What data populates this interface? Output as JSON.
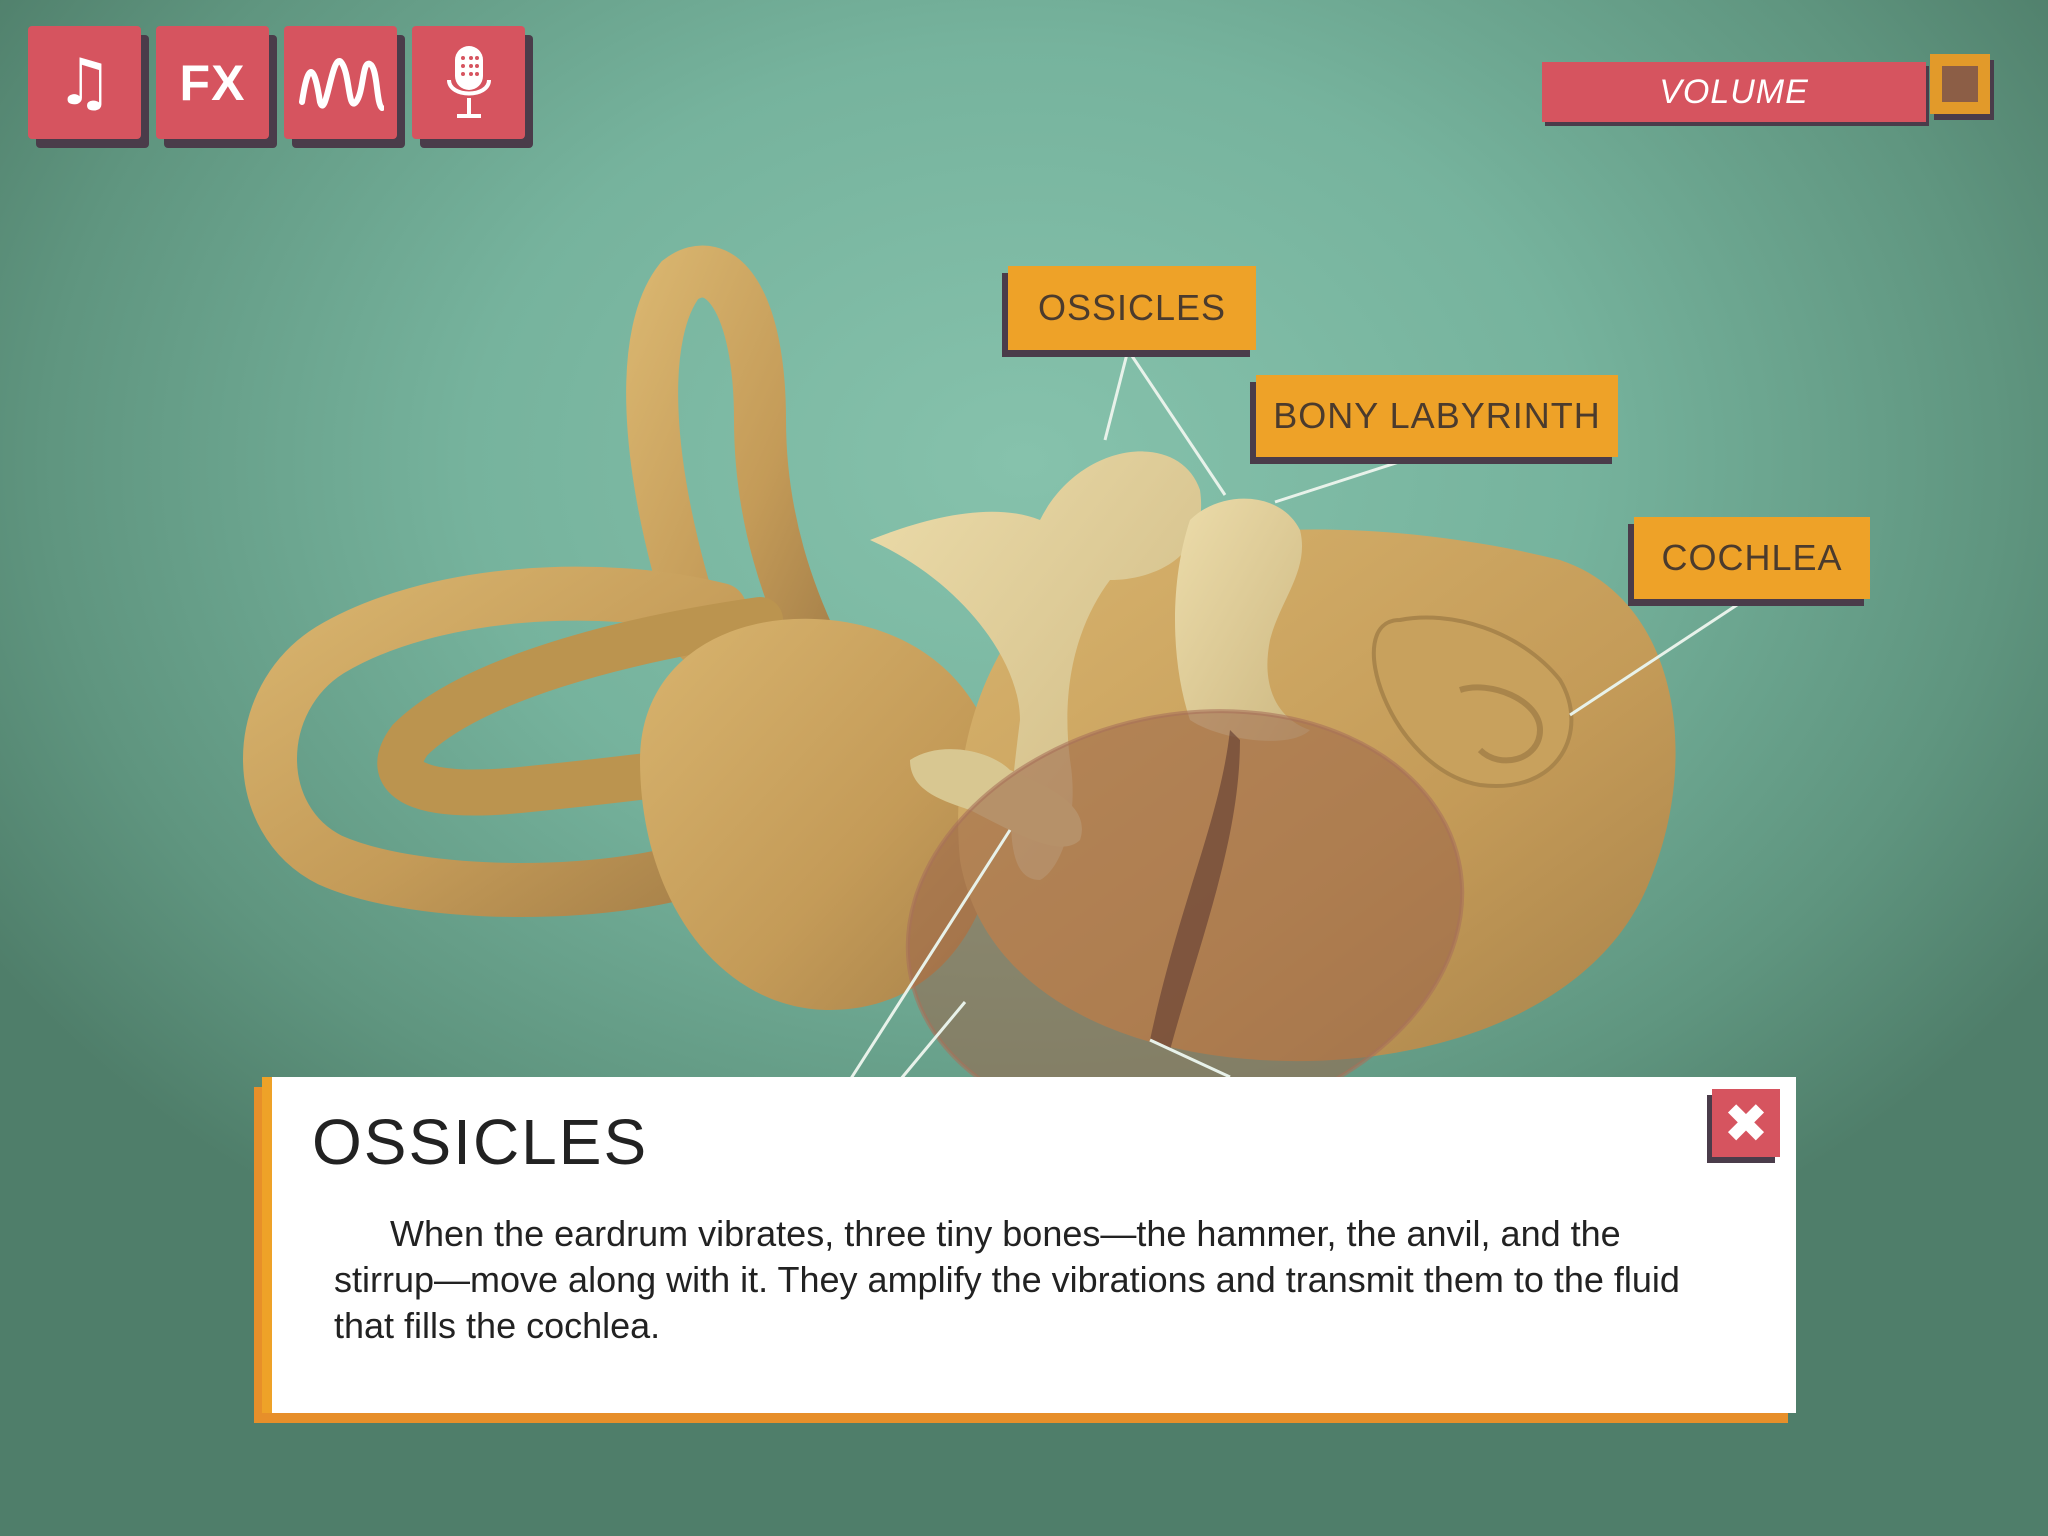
{
  "toolbar": {
    "buttons": [
      {
        "name": "music",
        "icon": "music-note-icon",
        "glyph": "♫"
      },
      {
        "name": "fx",
        "label": "FX"
      },
      {
        "name": "waveform",
        "icon": "waveform-icon"
      },
      {
        "name": "voice",
        "icon": "microphone-icon"
      }
    ],
    "button_color": "#d6545f"
  },
  "volume": {
    "label": "VOLUME",
    "knob_color": "#e29a2a"
  },
  "labels": {
    "ossicles": "OSSICLES",
    "bony_labyrinth": "BONY LABYRINTH",
    "cochlea": "COCHLEA"
  },
  "info_panel": {
    "title": "OSSICLES",
    "body": "When the eardrum vibrates, three tiny bones—the hammer, the anvil, and the stirrup—move along with it. They amplify the vibrations and transmit them to the fluid that fills the cochlea.",
    "close_glyph": "✖"
  },
  "colors": {
    "background": "#76b39d",
    "bone": "#c9a25e",
    "ossicle": "#dfcf95",
    "label": "#eea228",
    "shadow": "#4a3c4a"
  }
}
